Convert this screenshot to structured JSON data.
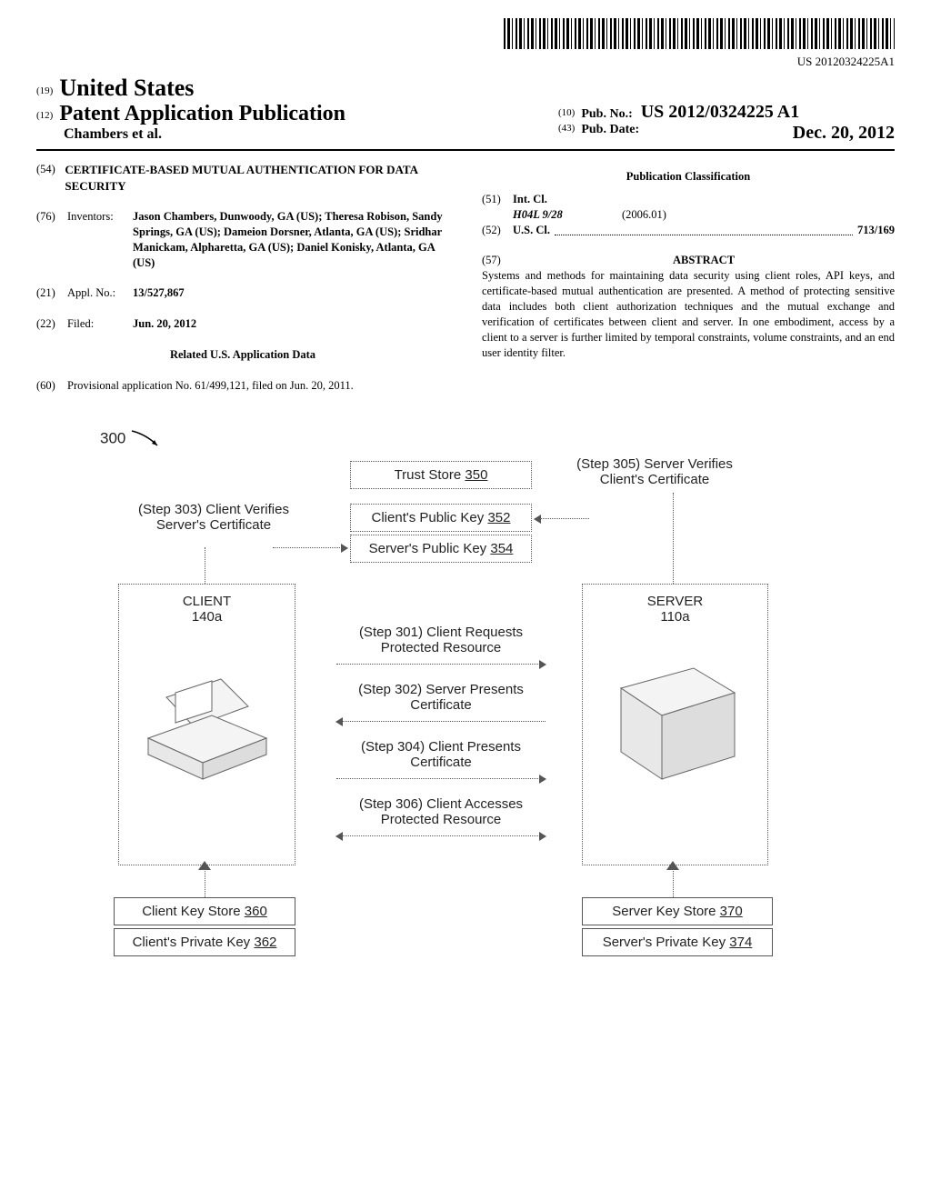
{
  "barcode_number": "US 20120324225A1",
  "header": {
    "code19": "(19)",
    "country": "United States",
    "code12": "(12)",
    "doc_type": "Patent Application Publication",
    "authors_line": "Chambers et al.",
    "code10": "(10)",
    "pubno_label": "Pub. No.:",
    "pubno_value": "US 2012/0324225 A1",
    "code43": "(43)",
    "pubdate_label": "Pub. Date:",
    "pubdate_value": "Dec. 20, 2012"
  },
  "left": {
    "c54": "(54)",
    "title": "CERTIFICATE-BASED MUTUAL AUTHENTICATION FOR DATA SECURITY",
    "c76": "(76)",
    "inventors_label": "Inventors:",
    "inventors": "Jason Chambers, Dunwoody, GA (US); Theresa Robison, Sandy Springs, GA (US); Dameion Dorsner, Atlanta, GA (US); Sridhar Manickam, Alpharetta, GA (US); Daniel Konisky, Atlanta, GA (US)",
    "c21": "(21)",
    "applno_label": "Appl. No.:",
    "applno_value": "13/527,867",
    "c22": "(22)",
    "filed_label": "Filed:",
    "filed_value": "Jun. 20, 2012",
    "related_head": "Related U.S. Application Data",
    "c60": "(60)",
    "provisional": "Provisional application No. 61/499,121, filed on Jun. 20, 2011."
  },
  "right": {
    "pubclass_head": "Publication Classification",
    "c51": "(51)",
    "intcl_label": "Int. Cl.",
    "intcl_code": "H04L 9/28",
    "intcl_date": "(2006.01)",
    "c52": "(52)",
    "uscl_label": "U.S. Cl.",
    "uscl_value": "713/169",
    "c57": "(57)",
    "abstract_head": "ABSTRACT",
    "abstract": "Systems and methods for maintaining data security using client roles, API keys, and certificate-based mutual authentication are presented. A method of protecting sensitive data includes both client authorization techniques and the mutual exchange and verification of certificates between client and server. In one embodiment, access by a client to a server is further limited by temporal constraints, volume constraints, and an end user identity filter."
  },
  "diagram": {
    "ref300": "300",
    "step303": "(Step 303) Client Verifies Server's Certificate",
    "step305": "(Step 305) Server Verifies Client's Certificate",
    "truststore": "Trust Store",
    "truststore_num": "350",
    "cpk": "Client's Public Key",
    "cpk_num": "352",
    "spk": "Server's Public Key",
    "spk_num": "354",
    "client_title": "CLIENT",
    "client_num": "140a",
    "server_title": "SERVER",
    "server_num": "110a",
    "step301": "(Step 301) Client Requests Protected Resource",
    "step302": "(Step 302) Server Presents Certificate",
    "step304": "(Step 304) Client Presents Certificate",
    "step306": "(Step 306) Client Accesses Protected Resource",
    "cks": "Client Key Store",
    "cks_num": "360",
    "cprk": "Client's Private Key",
    "cprk_num": "362",
    "sks": "Server Key Store",
    "sks_num": "370",
    "sprk": "Server's Private Key",
    "sprk_num": "374"
  }
}
